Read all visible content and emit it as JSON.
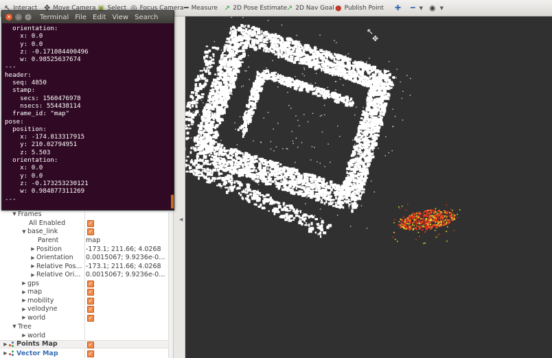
{
  "toolbar": {
    "tools": [
      {
        "id": "interact",
        "label": "Interact",
        "icon": "interact-icon"
      },
      {
        "id": "move-camera",
        "label": "Move Camera",
        "icon": "move-camera-icon"
      },
      {
        "id": "select",
        "label": "Select",
        "icon": "select-icon"
      },
      {
        "id": "focus-camera",
        "label": "Focus Camera",
        "icon": "focus-camera-icon"
      },
      {
        "id": "measure",
        "label": "Measure",
        "icon": "ruler-icon"
      },
      {
        "id": "pose-estimate",
        "label": "2D Pose Estimate",
        "icon": "green-arrow-icon"
      },
      {
        "id": "nav-goal",
        "label": "2D Nav Goal",
        "icon": "green-arrow-icon"
      },
      {
        "id": "publish-point",
        "label": "Publish Point",
        "icon": "map-pin-icon"
      }
    ]
  },
  "terminal": {
    "title": "Terminal",
    "menu": [
      "File",
      "Edit",
      "View",
      "Search"
    ],
    "lines": [
      "  orientation:",
      "    x: 0.0",
      "    y: 0.0",
      "    z: -0.171084400496",
      "    w: 0.98525637674",
      "---",
      "header:",
      "  seq: 4850",
      "  stamp:",
      "    secs: 1560476978",
      "    nsecs: 554438114",
      "  frame_id: \"map\"",
      "pose:",
      "  position:",
      "    x: -174.813317915",
      "    y: 210.02794951",
      "    z: 5.503",
      "  orientation:",
      "    x: 0.0",
      "    y: 0.0",
      "    z: -0.173253230121",
      "    w: 0.984877311269",
      "---"
    ]
  },
  "tree": {
    "frames": "Frames",
    "all_enabled": "All Enabled",
    "base_link": "base_link",
    "parent_label": "Parent",
    "parent_value": "map",
    "position_label": "Position",
    "position_value": "-173.1; 211.66; 4.0268",
    "orientation_label": "Orientation",
    "orientation_value": "0.0015067; 9.9236e-06; ...",
    "rel_pos_label": "Relative Pos...",
    "rel_pos_value": "-173.1; 211.66; 4.0268",
    "rel_ori_label": "Relative Ori...",
    "rel_ori_value": "0.0015067; 9.9236e-06; ...",
    "gps": "gps",
    "map": "map",
    "mobility": "mobility",
    "velodyne": "velodyne",
    "world": "world",
    "tree_label": "Tree",
    "tree_world": "world",
    "points_map": "Points Map",
    "vector_map": "Vector Map"
  },
  "colors": {
    "terminal_bg": "#300a24",
    "view_bg": "#303030",
    "checkbox": "#f08a4b",
    "points_red": "#e0321c",
    "points_yellow": "#d8e02a"
  }
}
